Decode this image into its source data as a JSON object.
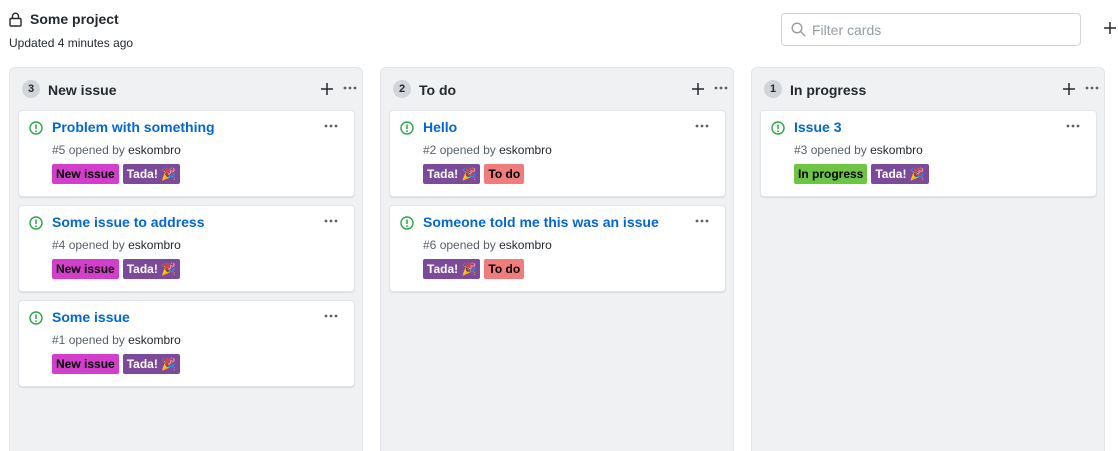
{
  "project": {
    "title": "Some project",
    "updated": "Updated 4 minutes ago"
  },
  "filter": {
    "placeholder": "Filter cards"
  },
  "colors": {
    "new_issue_label": "#d33ecc",
    "tada_label": "#7c4a9a",
    "todo_label": "#f07c7c",
    "in_progress_label": "#6cc644",
    "link": "#0366d6",
    "open_icon": "#28a745"
  },
  "columns": [
    {
      "count": "3",
      "title": "New issue",
      "cards": [
        {
          "title": "Problem with something",
          "number": "#5",
          "opened_by": "opened by",
          "author": "eskombro",
          "labels": [
            {
              "text": "New issue",
              "color": "#d33ecc",
              "fg": "#000000"
            },
            {
              "text": "Tada! 🎉",
              "color": "#7c4a9a",
              "fg": "#ffffff"
            }
          ]
        },
        {
          "title": "Some issue to address",
          "number": "#4",
          "opened_by": "opened by",
          "author": "eskombro",
          "labels": [
            {
              "text": "New issue",
              "color": "#d33ecc",
              "fg": "#000000"
            },
            {
              "text": "Tada! 🎉",
              "color": "#7c4a9a",
              "fg": "#ffffff"
            }
          ]
        },
        {
          "title": "Some issue",
          "number": "#1",
          "opened_by": "opened by",
          "author": "eskombro",
          "labels": [
            {
              "text": "New issue",
              "color": "#d33ecc",
              "fg": "#000000"
            },
            {
              "text": "Tada! 🎉",
              "color": "#7c4a9a",
              "fg": "#ffffff"
            }
          ]
        }
      ]
    },
    {
      "count": "2",
      "title": "To do",
      "cards": [
        {
          "title": "Hello",
          "number": "#2",
          "opened_by": "opened by",
          "author": "eskombro",
          "labels": [
            {
              "text": "Tada! 🎉",
              "color": "#7c4a9a",
              "fg": "#ffffff"
            },
            {
              "text": "To do",
              "color": "#f07c7c",
              "fg": "#000000"
            }
          ]
        },
        {
          "title": "Someone told me this was an issue",
          "number": "#6",
          "opened_by": "opened by",
          "author": "eskombro",
          "labels": [
            {
              "text": "Tada! 🎉",
              "color": "#7c4a9a",
              "fg": "#ffffff"
            },
            {
              "text": "To do",
              "color": "#f07c7c",
              "fg": "#000000"
            }
          ]
        }
      ]
    },
    {
      "count": "1",
      "title": "In progress",
      "cards": [
        {
          "title": "Issue 3",
          "number": "#3",
          "opened_by": "opened by",
          "author": "eskombro",
          "labels": [
            {
              "text": "In progress",
              "color": "#6cc644",
              "fg": "#000000"
            },
            {
              "text": "Tada! 🎉",
              "color": "#7c4a9a",
              "fg": "#ffffff"
            }
          ]
        }
      ]
    }
  ]
}
